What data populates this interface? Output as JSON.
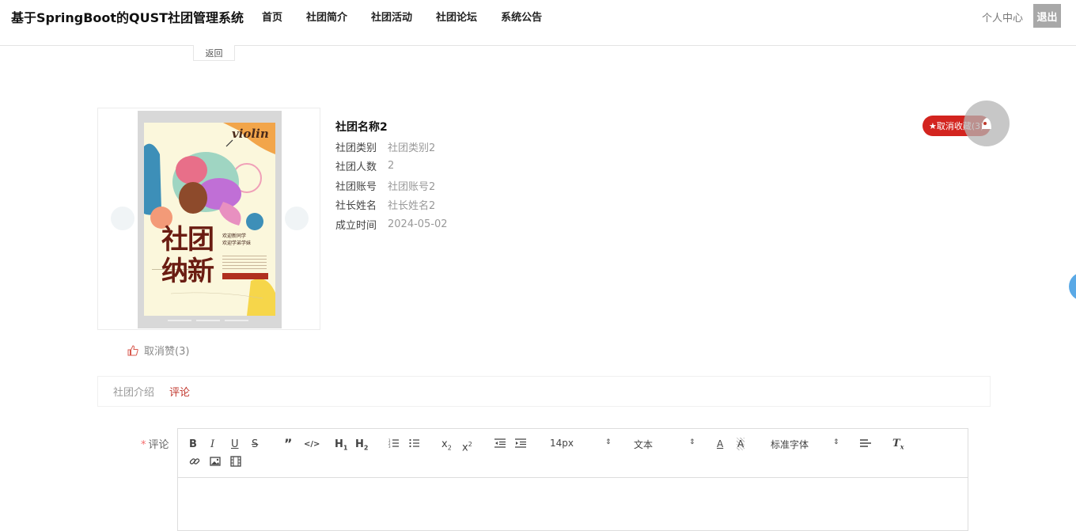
{
  "header": {
    "brand": "基于SpringBoot的QUST社团管理系统",
    "nav": [
      "首页",
      "社团简介",
      "社团活动",
      "社团论坛",
      "系统公告"
    ],
    "user_center": "个人中心",
    "logout": "退出"
  },
  "back_label": "返回",
  "poster": {
    "word_violin": "violin",
    "big_text_1": "社团",
    "big_text_2": "纳新",
    "side_line_1": "欢迎新同学",
    "side_line_2": "欢迎学弟学妹"
  },
  "detail": {
    "title": "社团名称2",
    "rows": [
      {
        "label": "社团类别",
        "value": "社团类别2"
      },
      {
        "label": "社团人数",
        "value": "2"
      },
      {
        "label": "社团账号",
        "value": "社团账号2"
      },
      {
        "label": "社长姓名",
        "value": "社长姓名2"
      },
      {
        "label": "成立时间",
        "value": "2024-05-02"
      }
    ]
  },
  "favorite_button": "★取消收藏(3)",
  "like_label": "取消赞(3)",
  "tabs": [
    {
      "label": "社团介绍",
      "active": false
    },
    {
      "label": "评论",
      "active": true
    }
  ],
  "comment": {
    "required_mark": "*",
    "label": "评论",
    "font_size": "14px",
    "text_type": "文本",
    "font_family": "标准字体"
  },
  "colors": {
    "accent": "#d3241f",
    "active_tab": "#c0352b",
    "logout_bg": "#a8a8a8"
  }
}
